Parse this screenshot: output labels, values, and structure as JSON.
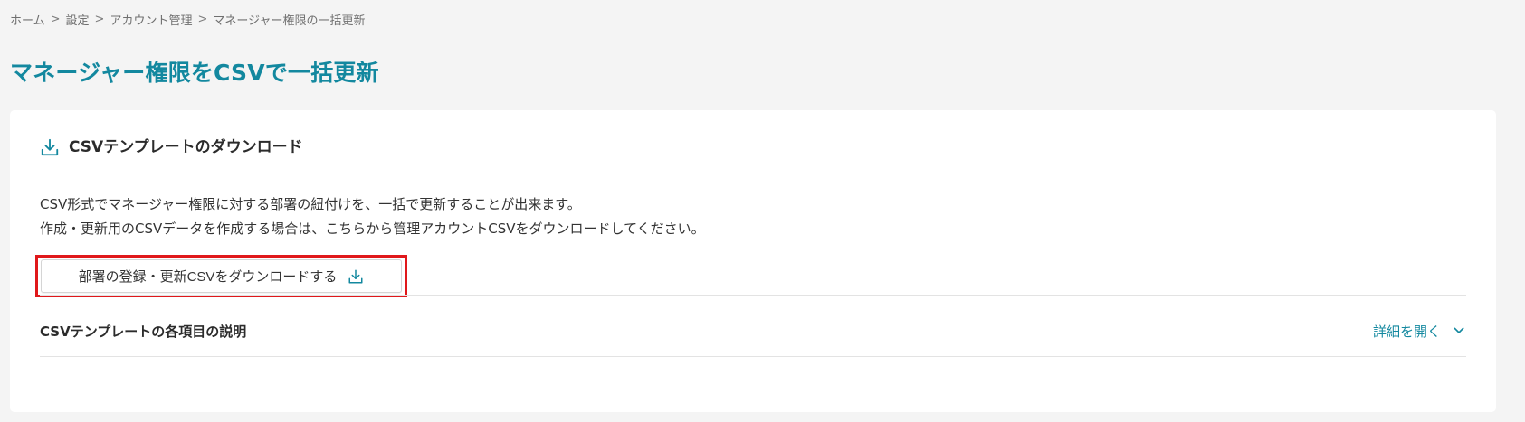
{
  "breadcrumb": {
    "items": [
      "ホーム",
      "設定",
      "アカウント管理",
      "マネージャー権限の一括更新"
    ],
    "separator": ">"
  },
  "page": {
    "title": "マネージャー権限をCSVで一括更新"
  },
  "template_section": {
    "title": "CSVテンプレートのダウンロード",
    "description_line1": "CSV形式でマネージャー権限に対する部署の紐付けを、一括で更新することが出来ます。",
    "description_line2": "作成・更新用のCSVデータを作成する場合は、こちらから管理アカウントCSVをダウンロードしてください。",
    "download_button_label": "部署の登録・更新CSVをダウンロードする"
  },
  "explanation_section": {
    "title": "CSVテンプレートの各項目の説明",
    "toggle_label": "詳細を開く"
  },
  "colors": {
    "accent": "#13889f",
    "highlight": "#e0181b",
    "background": "#f4f4f4"
  },
  "icons": {
    "section": "download-icon",
    "button": "download-icon",
    "toggle": "chevron-down-icon"
  }
}
